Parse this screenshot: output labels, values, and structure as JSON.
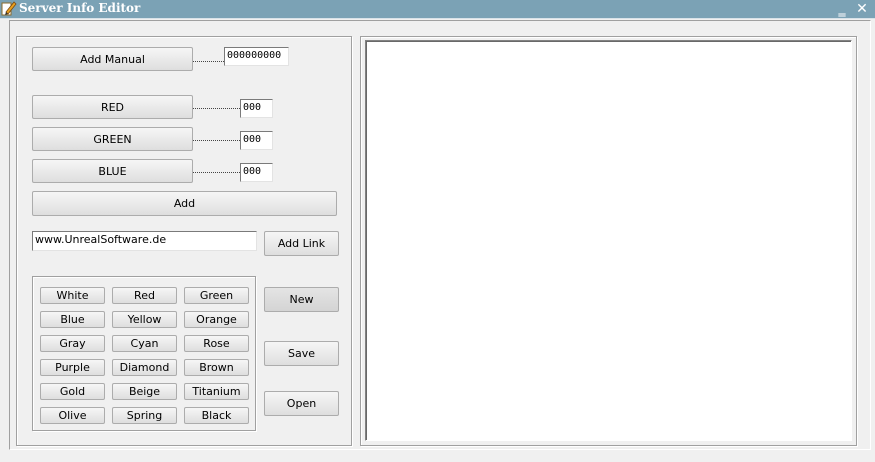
{
  "window": {
    "title": "Server Info Editor",
    "minimize_glyph": "‗",
    "close_glyph": "✕"
  },
  "color_section": {
    "add_manual_label": "Add Manual",
    "manual_value": "000000000",
    "red_label": "RED",
    "red_value": "000",
    "green_label": "GREEN",
    "green_value": "000",
    "blue_label": "BLUE",
    "blue_value": "000",
    "add_label": "Add"
  },
  "link": {
    "url_value": "www.UnrealSoftware.de",
    "add_link_label": "Add Link"
  },
  "palette": {
    "rows": [
      [
        "White",
        "Red",
        "Green"
      ],
      [
        "Blue",
        "Yellow",
        "Orange"
      ],
      [
        "Gray",
        "Cyan",
        "Rose"
      ],
      [
        "Purple",
        "Diamond",
        "Brown"
      ],
      [
        "Gold",
        "Beige",
        "Titanium"
      ],
      [
        "Olive",
        "Spring",
        "Black"
      ]
    ]
  },
  "file_actions": {
    "new_label": "New",
    "save_label": "Save",
    "open_label": "Open"
  },
  "editor": {
    "content": ""
  }
}
